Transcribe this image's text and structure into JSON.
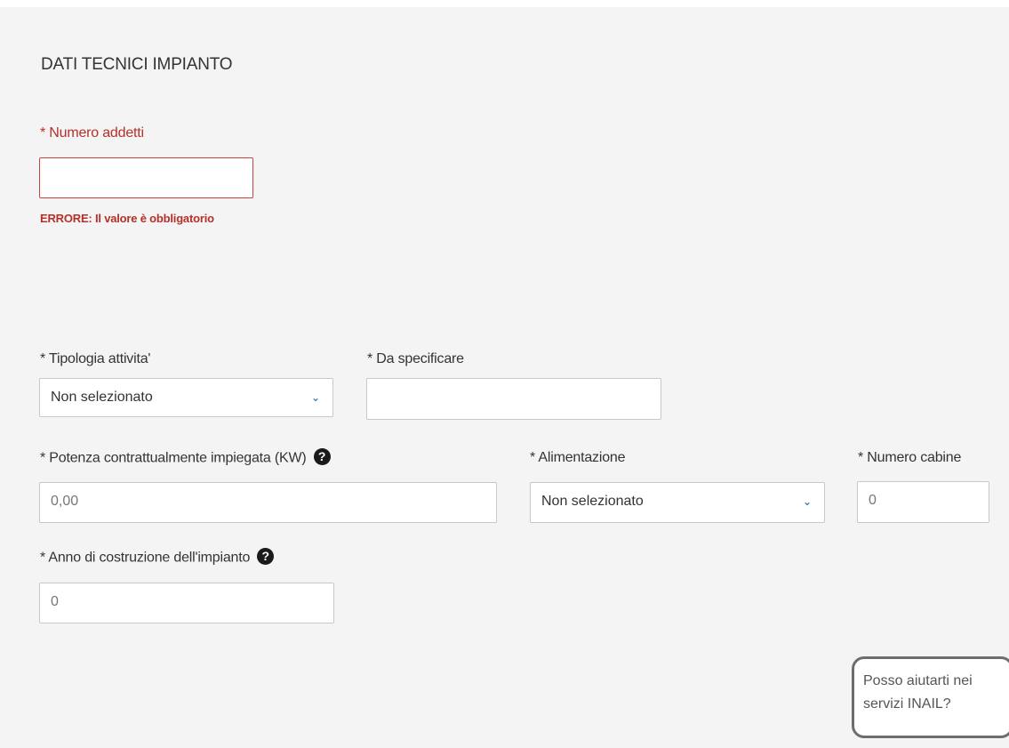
{
  "section": {
    "title": "DATI TECNICI IMPIANTO"
  },
  "numero_addetti": {
    "label": "* Numero addetti",
    "value": "",
    "error": "ERRORE: Il valore è obbligatorio"
  },
  "tipologia_attivita": {
    "label": "* Tipologia attivita'",
    "selected": "Non selezionato"
  },
  "da_specificare": {
    "label": "* Da specificare",
    "value": ""
  },
  "potenza": {
    "label": "* Potenza contrattualmente impiegata (KW)",
    "value": "0,00"
  },
  "alimentazione": {
    "label": "* Alimentazione",
    "selected": "Non selezionato"
  },
  "numero_cabine": {
    "label": "* Numero cabine",
    "value": "0"
  },
  "anno_costruzione": {
    "label": "* Anno di costruzione dell'impianto",
    "value": "0"
  },
  "help_icon": {
    "glyph": "?",
    "icon": "question-circle-icon"
  },
  "select_icon": {
    "glyph": "⌄",
    "icon": "chevron-down-icon"
  },
  "chat": {
    "line1": "Posso aiutarti nei",
    "line2": "servizi INAIL?"
  },
  "colors": {
    "error": "#b5302a",
    "panel_background": "#f4f4f4",
    "chevron": "#3b7bbf"
  }
}
